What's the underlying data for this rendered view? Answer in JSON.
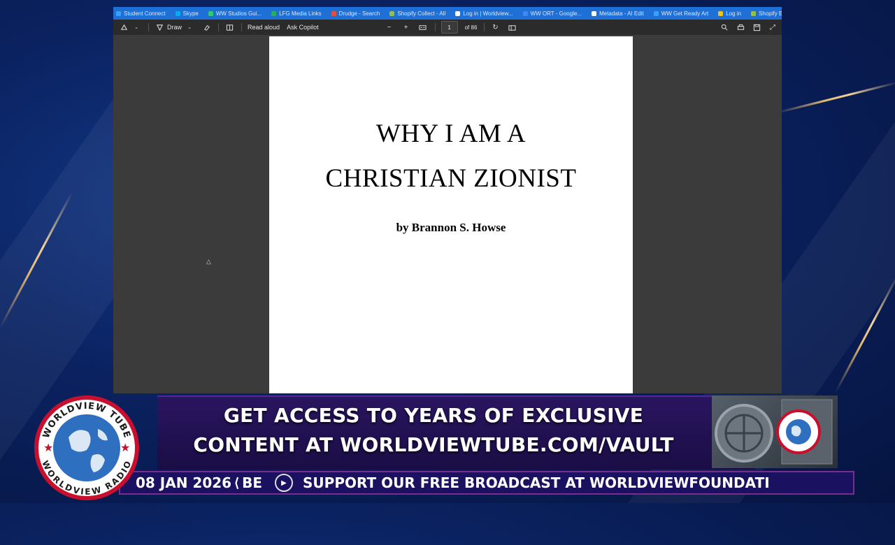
{
  "bookmarks": [
    {
      "label": "Student Connect",
      "color": "#3aa0ff"
    },
    {
      "label": "Skype",
      "color": "#00aff0"
    },
    {
      "label": "WW Studios Gui...",
      "color": "#2ecc71"
    },
    {
      "label": "LFG Media Links",
      "color": "#27ae60"
    },
    {
      "label": "Drudge - Search",
      "color": "#e74c3c"
    },
    {
      "label": "Shopify Collect - All",
      "color": "#95bf47"
    },
    {
      "label": "Log in | Worldview...",
      "color": "#ffffff"
    },
    {
      "label": "WW ORT - Google...",
      "color": "#4285f4"
    },
    {
      "label": "Metadata - AI Edit",
      "color": "#ffffff"
    },
    {
      "label": "WW Get Ready Art",
      "color": "#3aa0ff"
    },
    {
      "label": "Log in",
      "color": "#f1c40f"
    },
    {
      "label": "Shopify Edi...",
      "color": "#95bf47"
    }
  ],
  "toolbar": {
    "draw_label": "Draw",
    "read_aloud_label": "Read aloud",
    "ask_copilot_label": "Ask Copilot",
    "page_current": "1",
    "page_total": "of 86"
  },
  "document": {
    "title_line1": "WHY I AM A",
    "title_line2": "CHRISTIAN ZIONIST",
    "byline": "by Brannon S. Howse"
  },
  "banner": {
    "line1": "GET ACCESS TO YEARS OF EXCLUSIVE",
    "line2": "CONTENT AT WORLDVIEWTUBE.COM/VAULT"
  },
  "ticker": {
    "date": "08 JAN 2026",
    "fragment": "BE",
    "message": "SUPPORT OUR FREE BROADCAST AT WORLDVIEWFOUNDATI"
  },
  "logo": {
    "top_text": "WORLDVIEW TUBE",
    "bottom_text": "WORLDVIEW RADIO"
  },
  "colors": {
    "accent_gold": "#e0b870",
    "banner_purple": "#2a1560",
    "ticker_border": "#7d2b8f",
    "logo_red": "#c8102e"
  }
}
